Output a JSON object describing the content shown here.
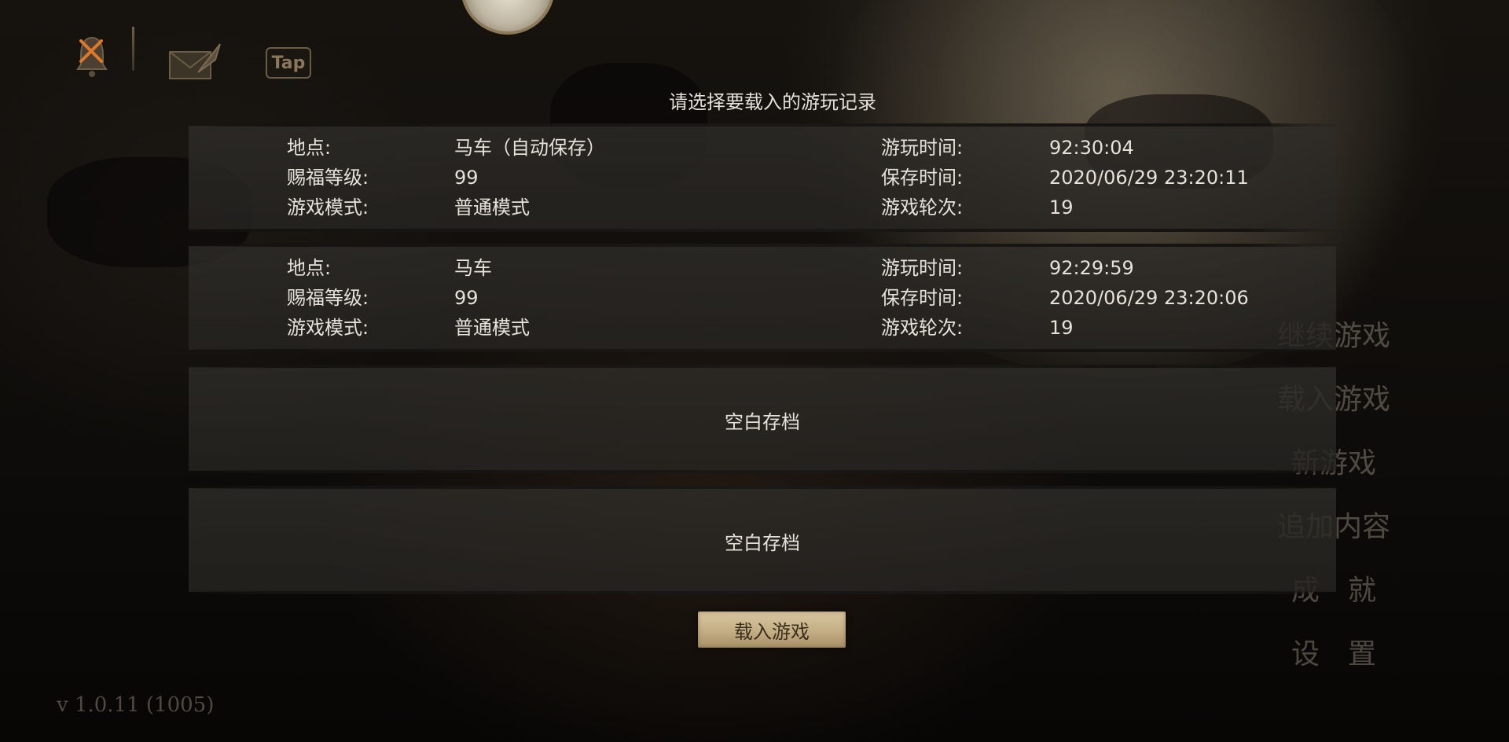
{
  "dialog": {
    "title": "请选择要载入的游玩记录",
    "slots": [
      {
        "location_label": "地点:",
        "location": "马车（自动保存）",
        "level_label": "赐福等级:",
        "level": "99",
        "mode_label": "游戏模式:",
        "mode": "普通模式",
        "playtime_label": "游玩时间:",
        "playtime": "92:30:04",
        "savetime_label": "保存时间:",
        "savetime": "2020/06/29 23:20:11",
        "round_label": "游戏轮次:",
        "round": "19"
      },
      {
        "location_label": "地点:",
        "location": "马车",
        "level_label": "赐福等级:",
        "level": "99",
        "mode_label": "游戏模式:",
        "mode": "普通模式",
        "playtime_label": "游玩时间:",
        "playtime": "92:29:59",
        "savetime_label": "保存时间:",
        "savetime": "2020/06/29 23:20:06",
        "round_label": "游戏轮次:",
        "round": "19"
      }
    ],
    "empty_slots": [
      "空白存档",
      "空白存档"
    ],
    "load_button": "载入游戏"
  },
  "top_bar": {
    "tap_label": "Tap",
    "icons": [
      "bell-muted-icon",
      "mail-icon",
      "tap-logo-icon",
      "avatar"
    ]
  },
  "menu": {
    "items": [
      "继续游戏",
      "载入游戏",
      "新游戏",
      "追加内容",
      "成　就",
      "设　置"
    ]
  },
  "version": "v 1.0.11 (1005)",
  "colors": {
    "text": "#e6e2da",
    "button_bg": "#c4ae84",
    "button_text": "#3a2e1c",
    "muted_icon_accent": "#e0782a"
  }
}
